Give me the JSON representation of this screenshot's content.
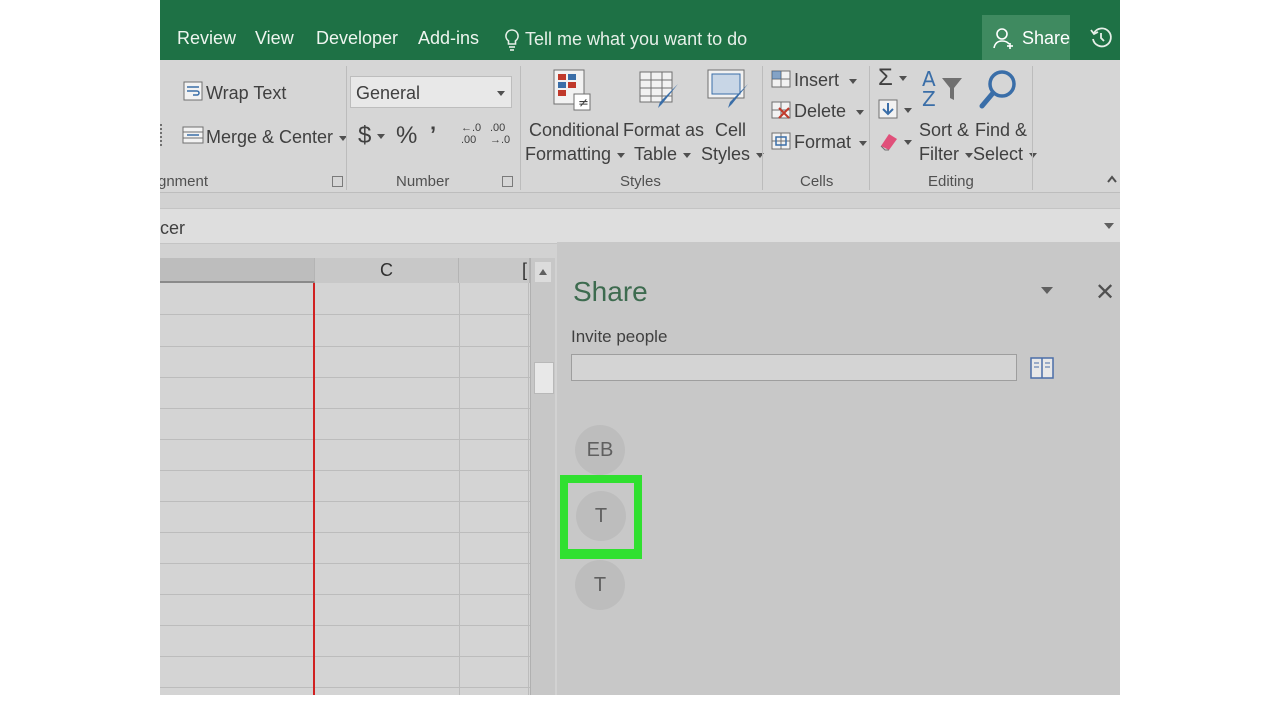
{
  "tabs": [
    "Review",
    "View",
    "Developer",
    "Add-ins"
  ],
  "tell_me": "Tell me what you want to do",
  "share_button": "Share",
  "ribbon": {
    "alignment": {
      "wrap_text": "Wrap Text",
      "merge_center": "Merge & Center",
      "label": "gnment"
    },
    "number": {
      "format_value": "General",
      "currency": "$",
      "percent": "%",
      "comma": "’",
      "inc_decimal": "←.0 .00",
      "dec_decimal": ".00 →.0",
      "label": "Number"
    },
    "styles": {
      "conditional_1": "Conditional",
      "conditional_2": "Formatting",
      "format_table_1": "Format as",
      "format_table_2": "Table",
      "cell_styles_1": "Cell",
      "cell_styles_2": "Styles",
      "label": "Styles"
    },
    "cells": {
      "insert": "Insert",
      "delete": "Delete",
      "format": "Format",
      "label": "Cells"
    },
    "editing": {
      "sort_1": "Sort &",
      "sort_2": "Filter",
      "find_1": "Find &",
      "find_2": "Select",
      "label": "Editing"
    }
  },
  "formula_bar_text": "cer",
  "columns": [
    {
      "label": ""
    },
    {
      "label": "C"
    },
    {
      "label": "["
    }
  ],
  "share_pane": {
    "title": "Share",
    "invite_label": "Invite people",
    "invite_value": "",
    "people": [
      "EB",
      "T",
      "T"
    ]
  },
  "colors": {
    "title_bar": "#1e7145",
    "highlight": "#30e030",
    "pane_title": "#3d6b4f"
  },
  "icons": [
    "lightbulb-icon",
    "person-icon",
    "history-icon",
    "wrap-text-icon",
    "merge-center-icon",
    "conditional-formatting-icon",
    "format-as-table-icon",
    "cell-styles-icon",
    "insert-cells-icon",
    "delete-cells-icon",
    "format-cells-icon",
    "autosum-icon",
    "fill-down-icon",
    "eraser-icon",
    "sort-filter-icon",
    "find-select-icon",
    "address-book-icon",
    "close-icon"
  ]
}
